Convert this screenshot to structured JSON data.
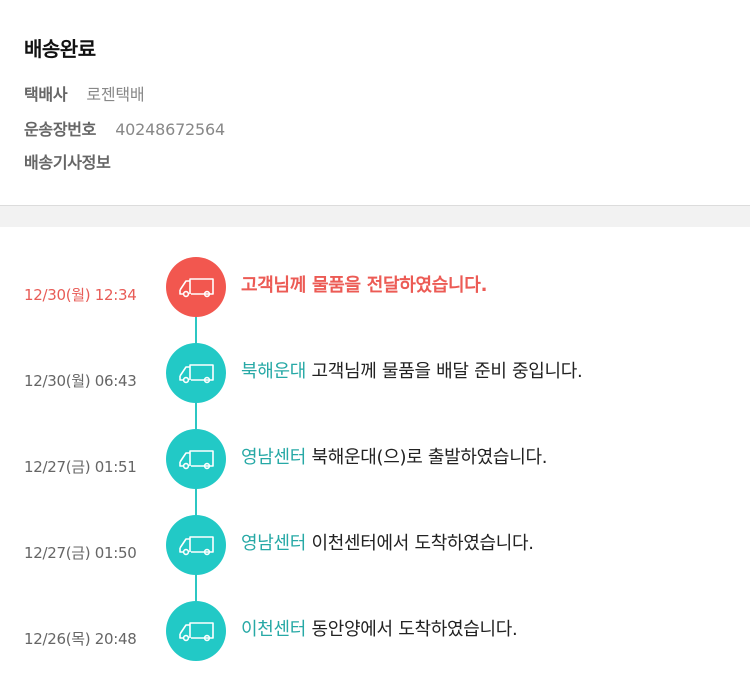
{
  "summary": {
    "status": "배송완료",
    "courier_label": "택배사",
    "courier_value": "로젠택배",
    "tracking_label": "운송장번호",
    "tracking_value": "40248672564",
    "driver_label": "배송기사정보"
  },
  "timeline": [
    {
      "time": "12/30(월) 12:34",
      "location": "",
      "message": "고객님께 물품을 전달하였습니다.",
      "current": true,
      "icon": "truck-icon"
    },
    {
      "time": "12/30(월) 06:43",
      "location": "북해운대",
      "message": "고객님께 물품을 배달 준비 중입니다.",
      "current": false,
      "icon": "truck-icon"
    },
    {
      "time": "12/27(금) 01:51",
      "location": "영남센터",
      "message": "북해운대(으)로 출발하였습니다.",
      "current": false,
      "icon": "truck-icon"
    },
    {
      "time": "12/27(금) 01:50",
      "location": "영남센터",
      "message": "이천센터에서 도착하였습니다.",
      "current": false,
      "icon": "truck-icon"
    },
    {
      "time": "12/26(목) 20:48",
      "location": "이천센터",
      "message": "동안양에서 도착하였습니다.",
      "current": false,
      "icon": "truck-icon"
    }
  ],
  "colors": {
    "current": "#f2574f",
    "past": "#22c9c6",
    "location_text": "#27a9a6"
  }
}
